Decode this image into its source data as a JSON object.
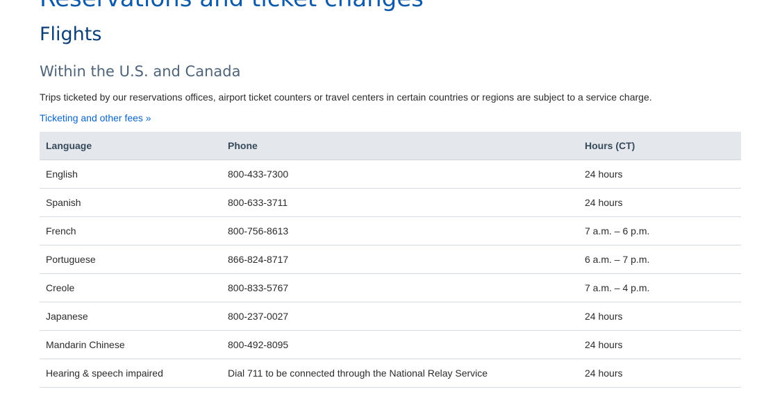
{
  "page_heading": "Reservations and ticket changes",
  "section_heading": "Flights",
  "sub_heading": "Within the U.S. and Canada",
  "intro_text": "Trips ticketed by our reservations offices, airport ticket counters or travel centers in certain countries or regions are subject to a service charge.",
  "fees_link": "Ticketing and other fees »",
  "table": {
    "headers": {
      "language": "Language",
      "phone": "Phone",
      "hours": "Hours (CT)"
    },
    "rows": [
      {
        "language": "English",
        "phone": "800-433-7300",
        "hours": "24 hours"
      },
      {
        "language": "Spanish",
        "phone": "800-633-3711",
        "hours": "24 hours"
      },
      {
        "language": "French",
        "phone": "800-756-8613",
        "hours": "7 a.m. – 6 p.m."
      },
      {
        "language": "Portuguese",
        "phone": "866-824-8717",
        "hours": "6 a.m. – 7 p.m."
      },
      {
        "language": "Creole",
        "phone": "800-833-5767",
        "hours": "7 a.m. – 4 p.m."
      },
      {
        "language": "Japanese",
        "phone": "800-237-0027",
        "hours": "24 hours"
      },
      {
        "language": "Mandarin Chinese",
        "phone": "800-492-8095",
        "hours": "24 hours"
      },
      {
        "language": "Hearing & speech impaired",
        "phone": "Dial 711 to be connected through the National Relay Service",
        "hours": "24 hours"
      }
    ]
  },
  "colors": {
    "link": "#0a63c7",
    "heading": "#0c3f78",
    "table_header_bg": "#e4e8ec"
  }
}
